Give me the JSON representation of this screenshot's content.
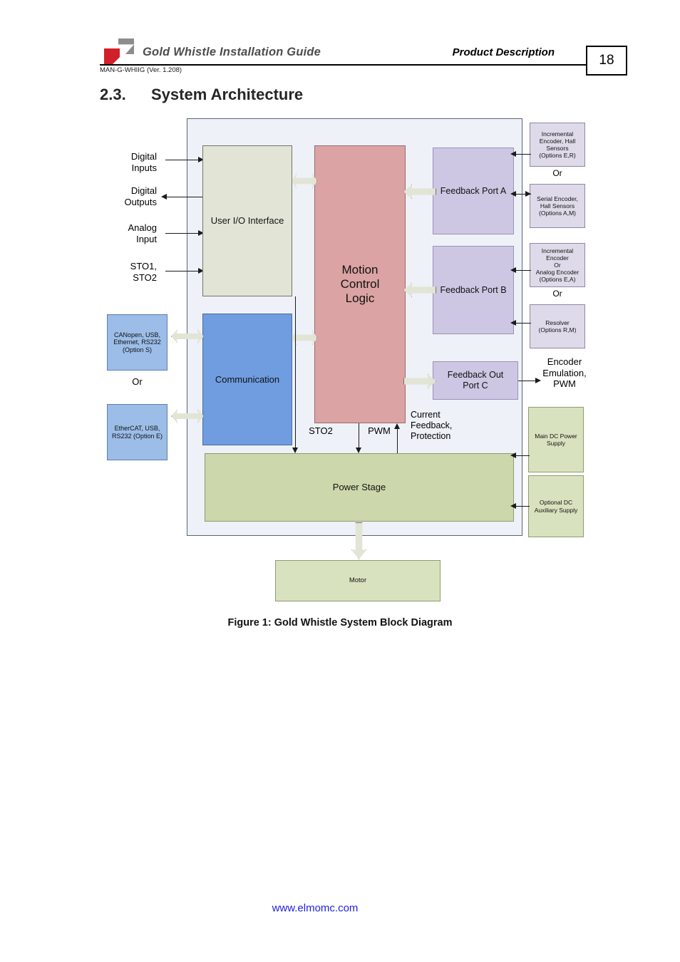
{
  "header": {
    "doc_title": "Gold Whistle Installation Guide",
    "doc_code": "MAN-G-WHIIG (Ver. 1.208)",
    "section_right": "Product Description",
    "page_number": "18",
    "logo_name": "elmo-logo"
  },
  "section": {
    "number": "2.3.",
    "title": "System Architecture"
  },
  "figure": {
    "caption": "Figure 1: Gold Whistle System Block Diagram"
  },
  "footer": {
    "link": "www.elmomc.com"
  },
  "colors": {
    "motion_control": "#dba3a3",
    "communication": "#6f9de0",
    "feedback_port": "#cdc7e3",
    "power_stage": "#ccd8ab",
    "user_io": "#e2e5d6",
    "option_box": "#9bbde8",
    "shell": "#eef1f7",
    "footer_link": "#2222dd",
    "logo_red": "#d2202a",
    "logo_gray": "#8d8d8d"
  },
  "diagram": {
    "blocks": {
      "user_io": "User I/O Interface",
      "motion_control": "Motion\nControl\nLogic",
      "communication": "Communication",
      "feedback_port_a": "Feedback Port A",
      "feedback_port_b": "Feedback Port B",
      "feedback_out_port_c": "Feedback Out\nPort C",
      "power_stage": "Power Stage",
      "motor": "Motor"
    },
    "left_signals": {
      "digital_inputs": "Digital\nInputs",
      "digital_outputs": "Digital\nOutputs",
      "analog_input": "Analog\nInput",
      "sto": "STO1,\nSTO2"
    },
    "left_options": {
      "option_s": "CANopen, USB,\nEthernet, RS232\n(Option S)",
      "or": "Or",
      "option_e": "EtherCAT, USB,\nRS232 (Option E)"
    },
    "right_options": {
      "encoder_er": "Incremental\nEncoder, Hall\nSensors\n(Options E,R)",
      "or_a": "Or",
      "encoder_am": "Serial Encoder,\nHall Sensors\n(Options A,M)",
      "encoder_ea": "Incremental\nEncoder\nOr\nAnalog Encoder\n(Options E,A)",
      "or_b": "Or",
      "resolver": "Resolver\n(Options R,M)"
    },
    "power": {
      "main_dc": "Main DC Power\nSupply",
      "aux_dc": "Optional DC\nAuxiliary Supply"
    },
    "inline_labels": {
      "sto2": "STO2",
      "pwm": "PWM",
      "current_feedback": "Current\nFeedback,\nProtection",
      "encoder_emulation": "Encoder\nEmulation,\nPWM"
    }
  }
}
